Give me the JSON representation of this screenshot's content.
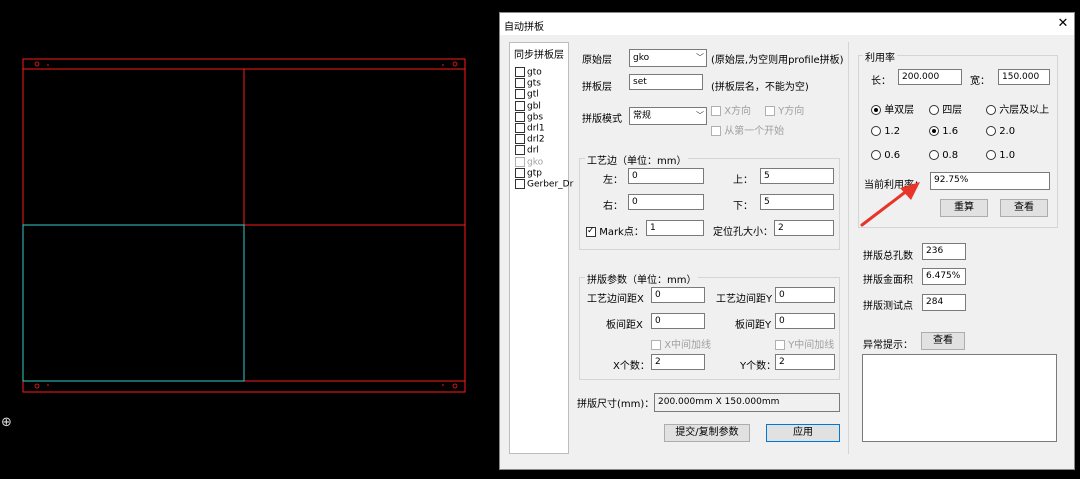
{
  "dialog": {
    "title": "自动拼板",
    "close": "✕"
  },
  "layers": {
    "title": "同步拼板层",
    "items": [
      {
        "name": "gto",
        "enabled": true
      },
      {
        "name": "gts",
        "enabled": true
      },
      {
        "name": "gtl",
        "enabled": true
      },
      {
        "name": "gbl",
        "enabled": true
      },
      {
        "name": "gbs",
        "enabled": true
      },
      {
        "name": "drl1",
        "enabled": true
      },
      {
        "name": "drl2",
        "enabled": true
      },
      {
        "name": "drl",
        "enabled": true
      },
      {
        "name": "gko",
        "enabled": false
      },
      {
        "name": "gtp",
        "enabled": true
      },
      {
        "name": "Gerber_Dr",
        "enabled": true
      }
    ]
  },
  "main": {
    "source_layer_label": "原始层",
    "source_layer_value": "gko",
    "source_layer_hint": "(原始层,为空则用profile拼板)",
    "panel_layer_label": "拼板层",
    "panel_layer_value": "set",
    "panel_layer_hint": "(拼板层名，不能为空)",
    "mode_label": "拼版模式",
    "mode_value": "常规",
    "x_dir": "X方向",
    "y_dir": "Y方向",
    "from_first": "从第一个开始"
  },
  "process_edge": {
    "title": "工艺边（单位：mm）",
    "left_label": "左：",
    "left_value": "0",
    "top_label": "上：",
    "top_value": "5",
    "right_label": "右：",
    "right_value": "0",
    "bottom_label": "下：",
    "bottom_value": "5",
    "mark_label": "Mark点：",
    "mark_value": "1",
    "hole_label": "定位孔大小：",
    "hole_value": "2"
  },
  "panel_params": {
    "title": "拼版参数（单位：mm）",
    "edge_gap_x_label": "工艺边间距X",
    "edge_gap_x_value": "0",
    "edge_gap_y_label": "工艺边间距Y",
    "edge_gap_y_value": "0",
    "board_gap_x_label": "板间距X",
    "board_gap_x_value": "0",
    "board_gap_y_label": "板间距Y",
    "board_gap_y_value": "0",
    "x_mid_line": "X中间加线",
    "y_mid_line": "Y中间加线",
    "x_count_label": "X个数：",
    "x_count_value": "2",
    "y_count_label": "Y个数：",
    "y_count_value": "2"
  },
  "panel_size": {
    "label": "拼版尺寸(mm)：",
    "value": "200.000mm X 150.000mm"
  },
  "buttons": {
    "submit_copy": "提交/复制参数",
    "apply": "应用"
  },
  "utilization": {
    "title": "利用率",
    "length_label": "长：",
    "length_value": "200.000",
    "width_label": "宽：",
    "width_value": "150.000",
    "layers_single": "单双层",
    "layers_four": "四层",
    "layers_six": "六层及以上",
    "t12": "1.2",
    "t16": "1.6",
    "t20": "2.0",
    "t06": "0.6",
    "t08": "0.8",
    "t10": "1.0",
    "current_label": "当前利用率：",
    "current_value": "92.75%",
    "recalc": "重算",
    "view": "查看"
  },
  "stats": {
    "holes_label": "拼版总孔数",
    "holes_value": "236",
    "gold_label": "拼版金面积",
    "gold_value": "6.475%",
    "test_label": "拼版测试点",
    "test_value": "284"
  },
  "abnormal": {
    "label": "异常提示：",
    "view": "查看"
  },
  "colors": {
    "board_outline": "#ff1a1a",
    "selected_outline": "#33cccc",
    "arrow": "#e8352a",
    "default_button_border": "#0078d7"
  }
}
